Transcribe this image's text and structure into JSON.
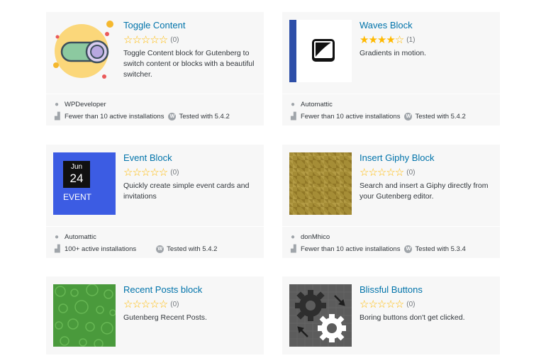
{
  "plugins": [
    {
      "title": "Toggle Content",
      "rating": 0,
      "count": "(0)",
      "desc": "Toggle Content block for Gutenberg to switch content or blocks with a beautiful switcher.",
      "author": "WPDeveloper",
      "installs": "Fewer than 10 active installations",
      "tested": "Tested with 5.4.2"
    },
    {
      "title": "Waves Block",
      "rating": 4,
      "count": "(1)",
      "desc": "Gradients in motion.",
      "author": "Automattic",
      "installs": "Fewer than 10 active installations",
      "tested": "Tested with 5.4.2"
    },
    {
      "title": "Event Block",
      "rating": 0,
      "count": "(0)",
      "desc": "Quickly create simple event cards and invitations",
      "author": "Automattic",
      "installs": "100+ active installations",
      "tested": "Tested with 5.4.2",
      "thumb_month": "Jun",
      "thumb_day": "24",
      "thumb_label": "EVENT"
    },
    {
      "title": "Insert Giphy Block",
      "rating": 0,
      "count": "(0)",
      "desc": "Search and insert a Giphy directly from your Gutenberg editor.",
      "author": "donMhico",
      "installs": "Fewer than 10 active installations",
      "tested": "Tested with 5.3.4"
    },
    {
      "title": "Recent Posts block",
      "rating": 0,
      "count": "(0)",
      "desc": "Gutenberg Recent Posts."
    },
    {
      "title": "Blissful Buttons",
      "rating": 0,
      "count": "(0)",
      "desc": "Boring buttons don't get clicked."
    }
  ],
  "icons": {
    "author": "user-icon",
    "installs": "chart-icon",
    "tested": "wordpress-icon"
  },
  "colors": {
    "link": "#0073aa",
    "star": "#ffb900",
    "card": "#f7f7f7",
    "event": "#3c5ce3",
    "waves": "#2e4fa8"
  }
}
